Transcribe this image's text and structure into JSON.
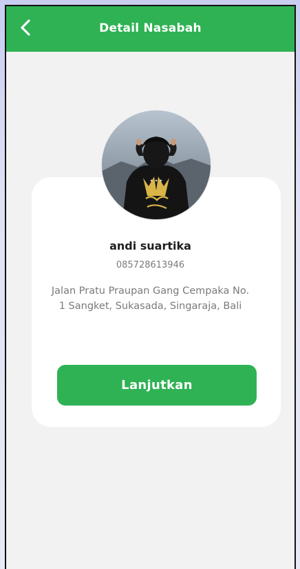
{
  "header": {
    "title": "Detail Nasabah",
    "back_icon": "chevron-left-icon"
  },
  "customer": {
    "name": "andi suartika",
    "phone": "085728613946",
    "address": "Jalan Pratu Praupan Gang Cempaka No. 1 Sangket, Sukasada, Singaraja, Bali"
  },
  "action": {
    "continue_label": "Lanjutkan"
  },
  "colors": {
    "primary": "#2fb254",
    "background": "#f2f2f2",
    "card": "#ffffff",
    "text_primary": "#1f1f1f",
    "text_secondary": "#7a7a7a"
  }
}
